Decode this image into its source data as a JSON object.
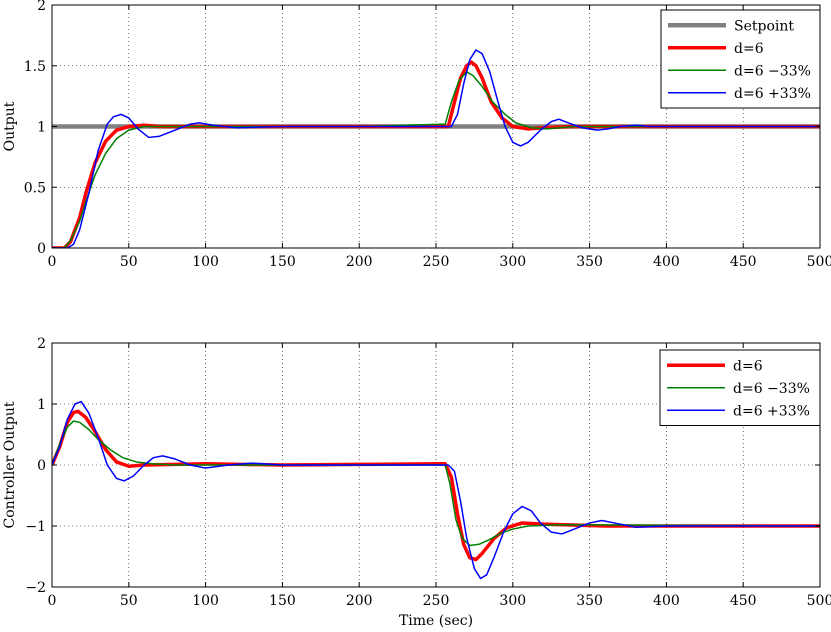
{
  "chart_data": [
    {
      "type": "line",
      "title": "",
      "xlabel": "",
      "ylabel": "Output",
      "xlim": [
        0,
        500
      ],
      "ylim": [
        0,
        2
      ],
      "xticks": [
        0,
        50,
        100,
        150,
        200,
        250,
        300,
        350,
        400,
        450,
        500
      ],
      "yticks": [
        0,
        0.5,
        1,
        1.5,
        2
      ],
      "ytick_labels": [
        "0",
        "0.5",
        "1",
        "1.5",
        "2"
      ],
      "grid": true,
      "legend_position": "top-right",
      "series": [
        {
          "name": "Setpoint",
          "color": "#808080",
          "points": [
            [
              0,
              1
            ],
            [
              500,
              1
            ]
          ]
        },
        {
          "name": "d=6",
          "color": "#ff0000",
          "points": [
            [
              0,
              0
            ],
            [
              8,
              0
            ],
            [
              12,
              0.05
            ],
            [
              18,
              0.25
            ],
            [
              22,
              0.45
            ],
            [
              28,
              0.7
            ],
            [
              35,
              0.88
            ],
            [
              42,
              0.97
            ],
            [
              50,
              1.0
            ],
            [
              60,
              1.01
            ],
            [
              70,
              1.0
            ],
            [
              100,
              1.0
            ],
            [
              200,
              1.0
            ],
            [
              256,
              1.0
            ],
            [
              258,
              1.0
            ],
            [
              262,
              1.2
            ],
            [
              266,
              1.4
            ],
            [
              270,
              1.5
            ],
            [
              273,
              1.53
            ],
            [
              276,
              1.5
            ],
            [
              280,
              1.4
            ],
            [
              286,
              1.2
            ],
            [
              293,
              1.07
            ],
            [
              300,
              1.0
            ],
            [
              310,
              0.98
            ],
            [
              320,
              0.99
            ],
            [
              340,
              1.0
            ],
            [
              500,
              1.0
            ]
          ]
        },
        {
          "name": "d=6 −33%",
          "color": "#008000",
          "points": [
            [
              0,
              0
            ],
            [
              8,
              0
            ],
            [
              12,
              0.06
            ],
            [
              18,
              0.22
            ],
            [
              22,
              0.38
            ],
            [
              28,
              0.6
            ],
            [
              35,
              0.78
            ],
            [
              42,
              0.9
            ],
            [
              50,
              0.97
            ],
            [
              60,
              1.0
            ],
            [
              70,
              1.0
            ],
            [
              100,
              1.0
            ],
            [
              200,
              1.0
            ],
            [
              256,
              1.02
            ],
            [
              260,
              1.2
            ],
            [
              265,
              1.38
            ],
            [
              270,
              1.45
            ],
            [
              274,
              1.42
            ],
            [
              280,
              1.33
            ],
            [
              287,
              1.2
            ],
            [
              295,
              1.1
            ],
            [
              302,
              1.03
            ],
            [
              312,
              0.99
            ],
            [
              322,
              0.98
            ],
            [
              340,
              1.0
            ],
            [
              500,
              1.0
            ]
          ]
        },
        {
          "name": "d=6 +33%",
          "color": "#0000ff",
          "points": [
            [
              0,
              0
            ],
            [
              10,
              0
            ],
            [
              14,
              0.03
            ],
            [
              18,
              0.15
            ],
            [
              24,
              0.45
            ],
            [
              30,
              0.8
            ],
            [
              36,
              1.02
            ],
            [
              40,
              1.08
            ],
            [
              45,
              1.1
            ],
            [
              50,
              1.07
            ],
            [
              56,
              0.98
            ],
            [
              63,
              0.91
            ],
            [
              70,
              0.92
            ],
            [
              80,
              0.97
            ],
            [
              90,
              1.02
            ],
            [
              96,
              1.03
            ],
            [
              105,
              1.01
            ],
            [
              120,
              0.99
            ],
            [
              150,
              1.0
            ],
            [
              200,
              1.0
            ],
            [
              256,
              1.0
            ],
            [
              260,
              1.0
            ],
            [
              264,
              1.1
            ],
            [
              268,
              1.35
            ],
            [
              272,
              1.55
            ],
            [
              276,
              1.63
            ],
            [
              280,
              1.6
            ],
            [
              285,
              1.45
            ],
            [
              290,
              1.22
            ],
            [
              295,
              1.0
            ],
            [
              300,
              0.87
            ],
            [
              305,
              0.84
            ],
            [
              310,
              0.87
            ],
            [
              318,
              0.97
            ],
            [
              325,
              1.04
            ],
            [
              330,
              1.06
            ],
            [
              336,
              1.03
            ],
            [
              345,
              0.99
            ],
            [
              355,
              0.97
            ],
            [
              362,
              0.98
            ],
            [
              370,
              1.0
            ],
            [
              380,
              1.01
            ],
            [
              390,
              1.0
            ],
            [
              500,
              1.0
            ]
          ]
        }
      ]
    },
    {
      "type": "line",
      "title": "",
      "xlabel": "Time (sec)",
      "ylabel": "Controller Output",
      "xlim": [
        0,
        500
      ],
      "ylim": [
        -2,
        2
      ],
      "xticks": [
        0,
        50,
        100,
        150,
        200,
        250,
        300,
        350,
        400,
        450,
        500
      ],
      "yticks": [
        -2,
        -1,
        0,
        1,
        2
      ],
      "ytick_labels": [
        "−2",
        "−1",
        "0",
        "1",
        "2"
      ],
      "grid": true,
      "legend_position": "top-right",
      "series": [
        {
          "name": "d=6",
          "color": "#ff0000",
          "points": [
            [
              0,
              0
            ],
            [
              5,
              0.3
            ],
            [
              10,
              0.7
            ],
            [
              14,
              0.86
            ],
            [
              17,
              0.88
            ],
            [
              22,
              0.78
            ],
            [
              28,
              0.55
            ],
            [
              35,
              0.25
            ],
            [
              42,
              0.05
            ],
            [
              50,
              -0.02
            ],
            [
              60,
              0.0
            ],
            [
              100,
              0.02
            ],
            [
              150,
              0.0
            ],
            [
              200,
              0.01
            ],
            [
              256,
              0.02
            ],
            [
              260,
              -0.2
            ],
            [
              264,
              -0.8
            ],
            [
              268,
              -1.3
            ],
            [
              272,
              -1.52
            ],
            [
              276,
              -1.55
            ],
            [
              280,
              -1.45
            ],
            [
              288,
              -1.2
            ],
            [
              296,
              -1.03
            ],
            [
              306,
              -0.95
            ],
            [
              320,
              -0.97
            ],
            [
              360,
              -1.0
            ],
            [
              500,
              -1.0
            ]
          ]
        },
        {
          "name": "d=6 −33%",
          "color": "#008000",
          "points": [
            [
              0,
              0
            ],
            [
              5,
              0.35
            ],
            [
              10,
              0.62
            ],
            [
              14,
              0.72
            ],
            [
              18,
              0.7
            ],
            [
              24,
              0.58
            ],
            [
              30,
              0.42
            ],
            [
              38,
              0.25
            ],
            [
              46,
              0.12
            ],
            [
              55,
              0.05
            ],
            [
              65,
              0.02
            ],
            [
              80,
              0.0
            ],
            [
              150,
              0.0
            ],
            [
              256,
              0.0
            ],
            [
              259,
              -0.3
            ],
            [
              263,
              -0.9
            ],
            [
              267,
              -1.2
            ],
            [
              272,
              -1.32
            ],
            [
              278,
              -1.3
            ],
            [
              285,
              -1.22
            ],
            [
              292,
              -1.12
            ],
            [
              300,
              -1.05
            ],
            [
              310,
              -1.0
            ],
            [
              330,
              -0.98
            ],
            [
              500,
              -1.0
            ]
          ]
        },
        {
          "name": "d=6 +33%",
          "color": "#0000ff",
          "points": [
            [
              0,
              0
            ],
            [
              5,
              0.3
            ],
            [
              10,
              0.75
            ],
            [
              15,
              1.0
            ],
            [
              19,
              1.04
            ],
            [
              24,
              0.85
            ],
            [
              30,
              0.45
            ],
            [
              36,
              0.0
            ],
            [
              42,
              -0.22
            ],
            [
              47,
              -0.26
            ],
            [
              53,
              -0.18
            ],
            [
              60,
              0.0
            ],
            [
              66,
              0.12
            ],
            [
              72,
              0.15
            ],
            [
              80,
              0.1
            ],
            [
              90,
              0.0
            ],
            [
              100,
              -0.05
            ],
            [
              115,
              0.0
            ],
            [
              130,
              0.03
            ],
            [
              150,
              0.0
            ],
            [
              200,
              0.0
            ],
            [
              258,
              0.0
            ],
            [
              262,
              -0.1
            ],
            [
              266,
              -0.6
            ],
            [
              270,
              -1.2
            ],
            [
              275,
              -1.7
            ],
            [
              279,
              -1.86
            ],
            [
              283,
              -1.8
            ],
            [
              288,
              -1.5
            ],
            [
              294,
              -1.1
            ],
            [
              300,
              -0.8
            ],
            [
              306,
              -0.68
            ],
            [
              312,
              -0.75
            ],
            [
              318,
              -0.95
            ],
            [
              325,
              -1.1
            ],
            [
              332,
              -1.13
            ],
            [
              340,
              -1.05
            ],
            [
              350,
              -0.95
            ],
            [
              358,
              -0.91
            ],
            [
              366,
              -0.95
            ],
            [
              380,
              -1.02
            ],
            [
              400,
              -1.0
            ],
            [
              500,
              -1.0
            ]
          ]
        }
      ]
    }
  ]
}
